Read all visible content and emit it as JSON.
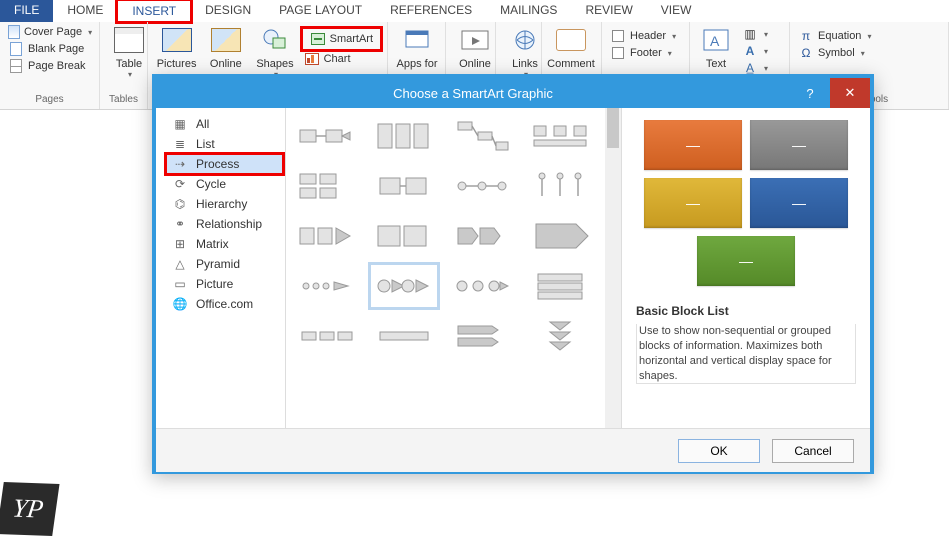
{
  "tabs": {
    "file": "FILE",
    "home": "HOME",
    "insert": "INSERT",
    "design": "DESIGN",
    "pagelayout": "PAGE LAYOUT",
    "references": "REFERENCES",
    "mailings": "MAILINGS",
    "review": "REVIEW",
    "view": "VIEW"
  },
  "pages": {
    "cover": "Cover Page",
    "blank": "Blank Page",
    "break": "Page Break",
    "group": "Pages"
  },
  "tables": {
    "table": "Table",
    "group": "Tables"
  },
  "illus": {
    "pictures": "Pictures",
    "online": "Online",
    "shapes": "Shapes",
    "smartart": "SmartArt",
    "chart": "Chart"
  },
  "apps": {
    "apps": "Apps for",
    "online": "Online"
  },
  "links": {
    "links": "Links"
  },
  "comments": {
    "comment": "Comment"
  },
  "headfoot": {
    "header": "Header",
    "footer": "Footer"
  },
  "text": {
    "text": "Text"
  },
  "symbols": {
    "equation": "Equation",
    "symbol": "Symbol",
    "group": "Symbols"
  },
  "dialog": {
    "title": "Choose a SmartArt Graphic",
    "help": "?",
    "close": "✕",
    "categories": {
      "all": "All",
      "list": "List",
      "process": "Process",
      "cycle": "Cycle",
      "hierarchy": "Hierarchy",
      "relationship": "Relationship",
      "matrix": "Matrix",
      "pyramid": "Pyramid",
      "picture": "Picture",
      "office": "Office.com"
    },
    "preview": {
      "title": "Basic Block List",
      "desc": "Use to show non-sequential or grouped blocks of information. Maximizes both horizontal and vertical display space for shapes."
    },
    "ok": "OK",
    "cancel": "Cancel"
  },
  "logo": "YP"
}
